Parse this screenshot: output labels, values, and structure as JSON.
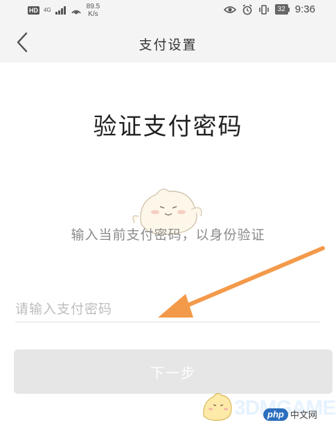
{
  "status_bar": {
    "hd": "HD",
    "network": "4G",
    "speed_value": "89.5",
    "speed_unit": "K/s",
    "battery": "32",
    "time": "9:36",
    "icons": [
      "eye-icon",
      "alarm-icon",
      "vibrate-icon",
      "battery-icon"
    ]
  },
  "nav": {
    "back_icon": "chevron-left-icon",
    "title": "支付设置"
  },
  "content": {
    "heading": "验证支付密码",
    "subtitle": "输入当前支付密码，以身份验证",
    "password_placeholder": "请输入支付密码",
    "next_label": "下一步"
  },
  "annotation": {
    "arrow_color": "#f39a4a"
  },
  "watermark": {
    "brand_3dm": "3DMGAME",
    "php_logo": "php",
    "php_text": "中文网"
  },
  "colors": {
    "bar_bg": "#f4f4f4",
    "button_disabled": "#e6e6e6",
    "placeholder": "#bdbdbd"
  }
}
